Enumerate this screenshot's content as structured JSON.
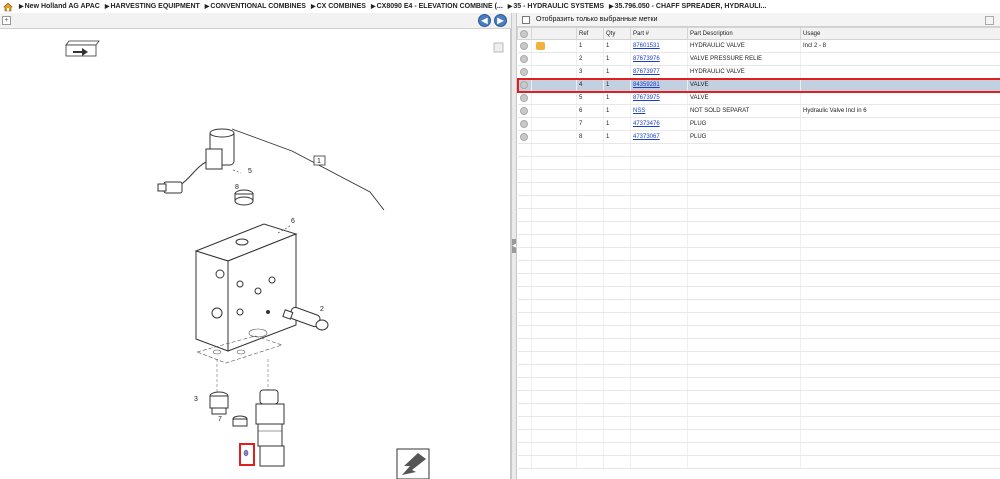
{
  "breadcrumb": {
    "items": [
      "New Holland AG APAC",
      "HARVESTING EQUIPMENT",
      "CONVENTIONAL COMBINES",
      "CX COMBINES",
      "CX8090 E4 - ELEVATION COMBINE (...",
      "35 - HYDRAULIC SYSTEMS",
      "35.796.050 - CHAFF SPREADER, HYDRAULI..."
    ],
    "separator": "▶",
    "home_icon": "home-icon"
  },
  "left_toolbar": {
    "collapse": "+",
    "prev": "◀",
    "next": "▶"
  },
  "drawing": {
    "callouts": [
      "1",
      "2",
      "3",
      "5",
      "6",
      "7",
      "8"
    ],
    "highlighted_part": "4"
  },
  "right_toolbar": {
    "filter_label": "Отобразить только выбранные метки"
  },
  "grid": {
    "headers": [
      "",
      "",
      "Ref",
      "Qty",
      "Part #",
      "Part Description",
      "Usage"
    ],
    "rows": [
      {
        "ref": "1",
        "qty": "1",
        "part": "87601531",
        "desc": "HYDRAULIC VALVE",
        "usage": "Incl 2 - 8",
        "note": true,
        "selected": false
      },
      {
        "ref": "2",
        "qty": "1",
        "part": "87673976",
        "desc": "VALVE PRESSURE RELIE",
        "usage": "",
        "note": false,
        "selected": false
      },
      {
        "ref": "3",
        "qty": "1",
        "part": "87673977",
        "desc": "HYDRAULIC VALVE",
        "usage": "",
        "note": false,
        "selected": false
      },
      {
        "ref": "4",
        "qty": "1",
        "part": "84359281",
        "desc": "VALVE",
        "usage": "",
        "note": false,
        "selected": true
      },
      {
        "ref": "5",
        "qty": "1",
        "part": "87673975",
        "desc": "VALVE",
        "usage": "",
        "note": false,
        "selected": false
      },
      {
        "ref": "6",
        "qty": "1",
        "part": "NSS",
        "desc": "NOT SOLD SEPARAT",
        "usage": "Hydraulic Valve Incl in 6",
        "note": false,
        "selected": false
      },
      {
        "ref": "7",
        "qty": "1",
        "part": "47373476",
        "desc": "PLUG",
        "usage": "",
        "note": false,
        "selected": false
      },
      {
        "ref": "8",
        "qty": "1",
        "part": "47373067",
        "desc": "PLUG",
        "usage": "",
        "note": false,
        "selected": false
      }
    ]
  },
  "colors": {
    "selection": "#c2d0e0",
    "highlight": "#e02020",
    "link": "#1a3fcc"
  }
}
